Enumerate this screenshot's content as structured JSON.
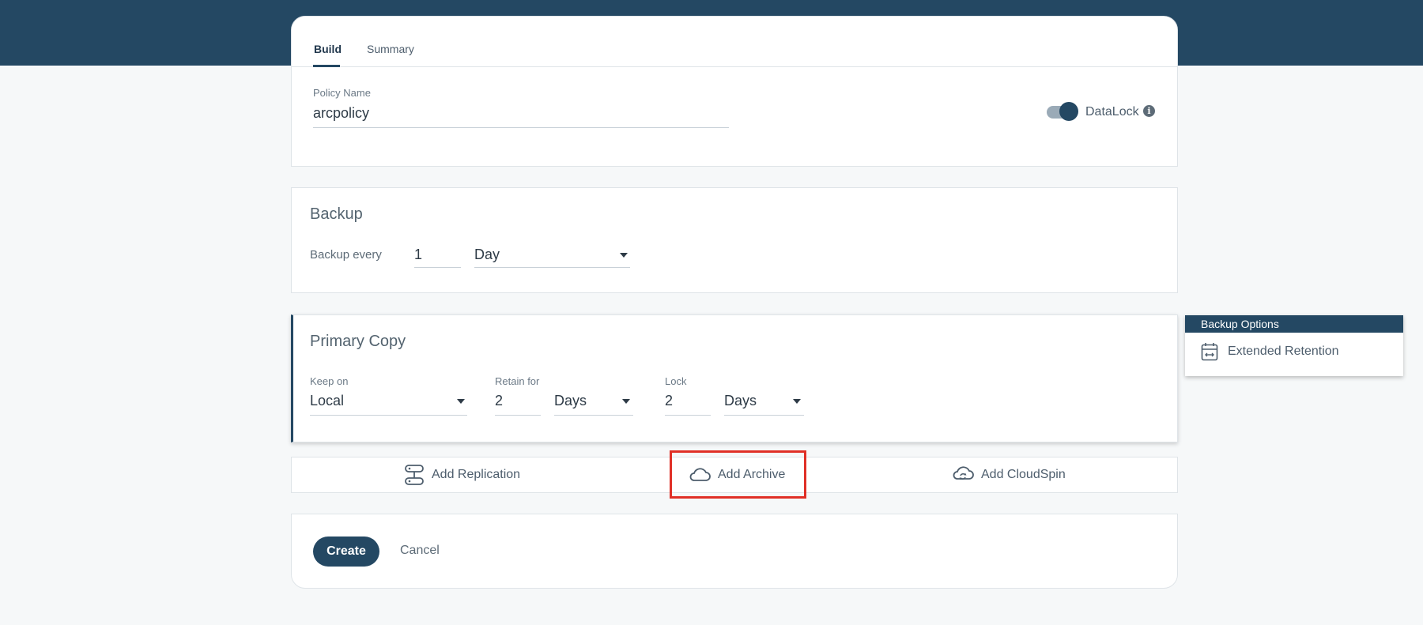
{
  "tabs": [
    {
      "label": "Build",
      "active": true
    },
    {
      "label": "Summary",
      "active": false
    }
  ],
  "policy": {
    "name_label": "Policy Name",
    "name_value": "arcpolicy",
    "datalock_label": "DataLock",
    "datalock_enabled": true,
    "info_icon_glyph": "i"
  },
  "backup": {
    "title": "Backup",
    "every_label": "Backup every",
    "every_value": "1",
    "unit_value": "Day"
  },
  "primary_copy": {
    "title": "Primary Copy",
    "keep_on_label": "Keep on",
    "keep_on_value": "Local",
    "retain_label": "Retain for",
    "retain_value": "2",
    "retain_unit": "Days",
    "lock_label": "Lock",
    "lock_value": "2",
    "lock_unit": "Days"
  },
  "actions": {
    "replication": "Add Replication",
    "archive": "Add Archive",
    "cloudspin": "Add CloudSpin"
  },
  "footer": {
    "create_label": "Create",
    "cancel_label": "Cancel"
  },
  "backup_options": {
    "header": "Backup Options",
    "item": "Extended Retention"
  },
  "colors": {
    "brand": "#244863",
    "highlight": "#e03027",
    "background": "#f6f8f9"
  },
  "icons": {
    "replication": "replication-icon",
    "archive": "cloud-icon",
    "cloudspin": "cloud-sync-icon",
    "extended_retention": "calendar-icon",
    "info": "info-icon"
  }
}
